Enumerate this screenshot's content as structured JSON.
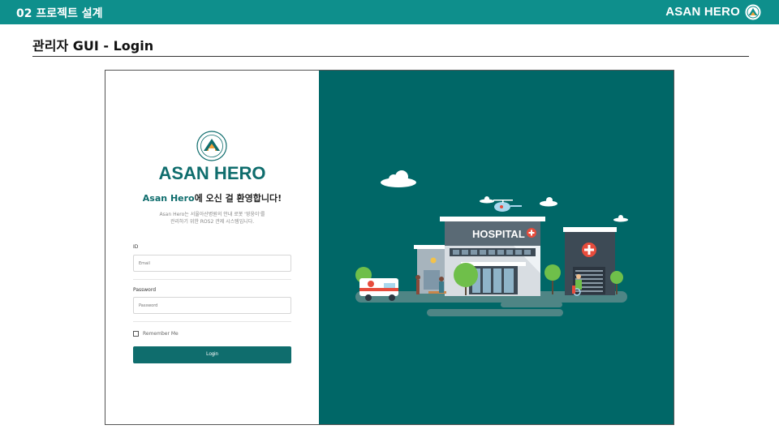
{
  "header": {
    "section_title": "02 프로젝트 설계",
    "brand": "ASAN HERO"
  },
  "slide": {
    "title": "관리자 GUI - Login"
  },
  "login": {
    "brand": "ASAN HERO",
    "welcome_highlight": "Asan Hero",
    "welcome_rest": "에 오신 걸 환영합니다!",
    "description_line1": "Asan Hero는 서울아산병원의 안내 로봇 '영웅이'를",
    "description_line2": "관리하기 위한 ROS2 관제 시스템입니다.",
    "id_label": "ID",
    "id_placeholder": "Email",
    "password_label": "Password",
    "password_placeholder": "Password",
    "remember_label": "Remember Me",
    "login_button": "Login"
  },
  "illustration": {
    "hospital_sign": "HOSPITAL",
    "background_color": "#006767",
    "accent_color": "#0f6d6d"
  }
}
